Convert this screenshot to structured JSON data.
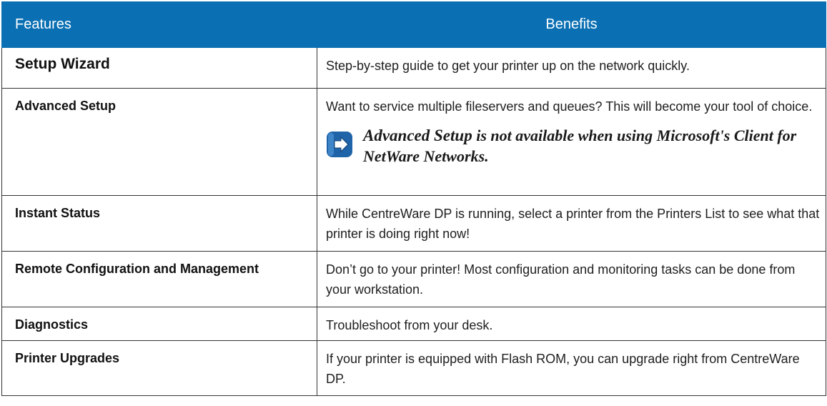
{
  "header": {
    "features_label": "Features",
    "benefits_label": "Benefits"
  },
  "rows": [
    {
      "feature": "Setup Wizard",
      "benefit": "Step-by-step guide to get your printer up on the network quickly."
    },
    {
      "feature": "Advanced Setup",
      "benefit": "Want to service multiple fileservers and queues? This will become your tool of choice.",
      "note": {
        "icon": "arrow-right-note-icon",
        "emphasis": "Advanced Setup",
        "text": " is not available when using Microsoft's Client for NetWare Networks."
      }
    },
    {
      "feature": "Instant Status",
      "benefit": "While CentreWare DP is running, select a printer from the Printers List to see what that printer is doing right now!"
    },
    {
      "feature": "Remote Configuration and Management",
      "benefit": "Don’t go to your printer!  Most configuration and monitoring tasks can be done from your workstation."
    },
    {
      "feature": "Diagnostics",
      "benefit": "Troubleshoot from your desk."
    },
    {
      "feature": "Printer Upgrades",
      "benefit": "If your printer is equipped with Flash ROM, you can upgrade right from CentreWare DP."
    }
  ],
  "colors": {
    "header_bg": "#0a6fb3",
    "icon_blue": "#1f63a8"
  }
}
